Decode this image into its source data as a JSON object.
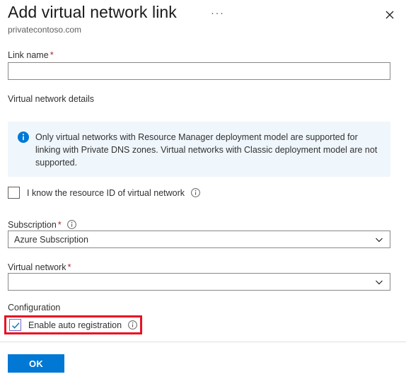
{
  "header": {
    "title": "Add virtual network link",
    "subtitle": "privatecontoso.com",
    "more_icon": "···",
    "more_label": "More",
    "close_label": "Close"
  },
  "form": {
    "link_name": {
      "label": "Link name",
      "required_marker": "*",
      "value": "",
      "placeholder": ""
    },
    "section_vnet_details": "Virtual network details",
    "banner": {
      "icon": "info-icon",
      "text": "Only virtual networks with Resource Manager deployment model are supported for linking with Private DNS zones. Virtual networks with Classic deployment model are not supported."
    },
    "resource_id_checkbox": {
      "label": "I know the resource ID of virtual network",
      "checked": false,
      "info_icon": "info-icon"
    },
    "subscription": {
      "label": "Subscription",
      "required_marker": "*",
      "info_icon": "info-icon",
      "value": "Azure Subscription"
    },
    "virtual_network": {
      "label": "Virtual network",
      "required_marker": "*",
      "value": ""
    },
    "section_configuration": "Configuration",
    "auto_registration_checkbox": {
      "label": "Enable auto registration",
      "checked": true,
      "info_icon": "info-icon"
    }
  },
  "footer": {
    "ok_label": "OK"
  },
  "colors": {
    "accent": "#0078d4",
    "required": "#a4262c",
    "banner_bg": "#eff6fc",
    "annotation": "#e81123",
    "checkbox_checked_border": "#8661c5"
  }
}
